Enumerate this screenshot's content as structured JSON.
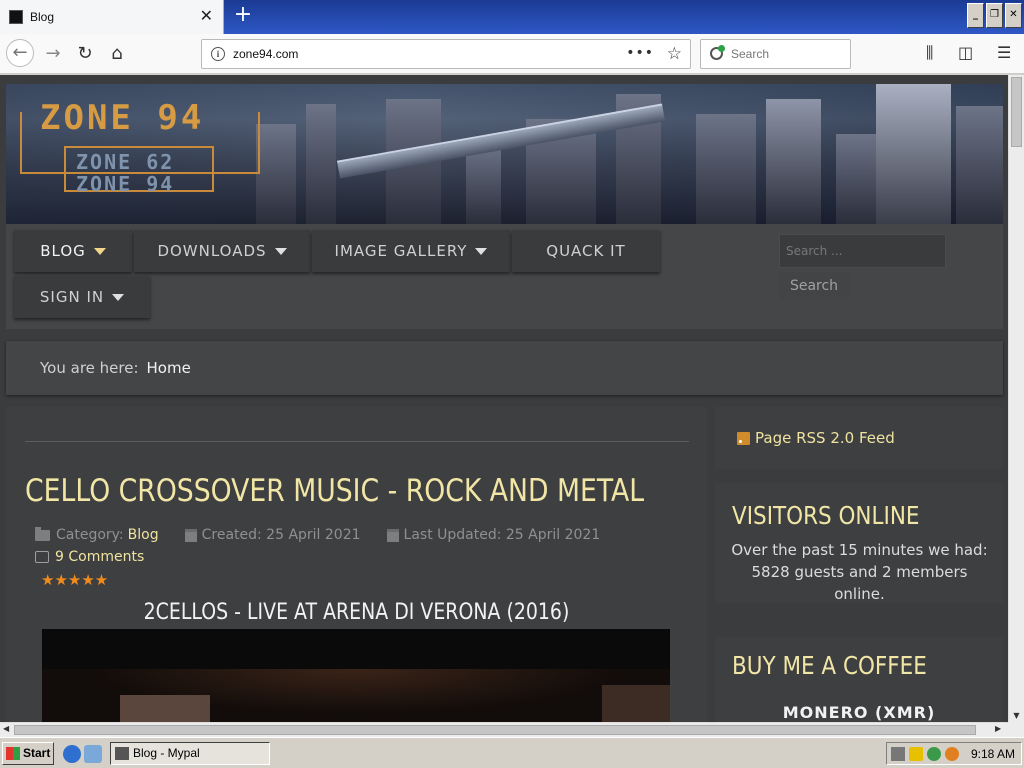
{
  "browser": {
    "tab_title": "Blog",
    "tab_close": "✕",
    "new_tab": "+",
    "url": "zone94.com",
    "url_more": "•••",
    "search_placeholder": "Search"
  },
  "site": {
    "logo_main": "ZONE 94",
    "logo_sub1": "ZONE 62",
    "logo_sub2": "ZONE 94",
    "menu": [
      {
        "label": "BLOG"
      },
      {
        "label": "DOWNLOADS"
      },
      {
        "label": "IMAGE GALLERY"
      },
      {
        "label": "QUACK IT"
      },
      {
        "label": "SIGN IN"
      }
    ],
    "search_placeholder": "Search ...",
    "search_button": "Search",
    "breadcrumb_label": "You are here:",
    "breadcrumb_home": "Home"
  },
  "article": {
    "title": "CELLO CROSSOVER MUSIC - ROCK AND METAL",
    "category_label": "Category:",
    "category": "Blog",
    "created": "Created: 25 April 2021",
    "updated": "Last Updated: 25 April 2021",
    "comments": "9 Comments",
    "rating_stars": "★★★★★",
    "rating_value": 5,
    "video_title": "2CELLOS - LIVE AT ARENA DI VERONA (2016)"
  },
  "sidebar": {
    "rss": "Page RSS 2.0 Feed",
    "visitors_title": "VISITORS ONLINE",
    "visitors_text": "Over the past 15 minutes we had: 5828 guests and 2 members online.",
    "coffee_title": "BUY ME A COFFEE",
    "monero": "MONERO (XMR)"
  },
  "taskbar": {
    "start": "Start",
    "task_item": "Blog - Mypal",
    "clock": "9:18 AM"
  },
  "colors": {
    "accent_gold": "#f1e6a6",
    "page_bg": "#3b3c3e",
    "star_orange": "#f08b1e",
    "logo_orange": "#d79b44"
  }
}
